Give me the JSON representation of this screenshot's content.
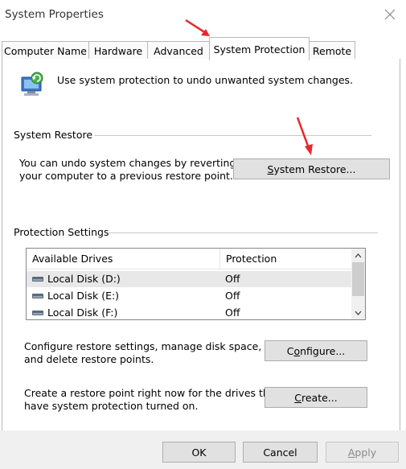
{
  "window": {
    "title": "System Properties"
  },
  "tabs": [
    {
      "label": "Computer Name"
    },
    {
      "label": "Hardware"
    },
    {
      "label": "Advanced"
    },
    {
      "label": "System Protection"
    },
    {
      "label": "Remote"
    }
  ],
  "intro": {
    "text": "Use system protection to undo unwanted system changes."
  },
  "system_restore": {
    "heading": "System Restore",
    "desc_line1": "You can undo system changes by reverting",
    "desc_line2": "your computer to a previous restore point.",
    "button": {
      "mnemonic": "S",
      "rest": "ystem Restore..."
    }
  },
  "protection": {
    "heading": "Protection Settings",
    "columns": [
      "Available Drives",
      "Protection"
    ],
    "drives": [
      {
        "name": "Local Disk (D:)",
        "protection": "Off"
      },
      {
        "name": "Local Disk (E:)",
        "protection": "Off"
      },
      {
        "name": "Local Disk (F:)",
        "protection": "Off"
      }
    ],
    "configure_line1": "Configure restore settings, manage disk space,",
    "configure_line2": "and delete restore points.",
    "configure_button": {
      "pre": "C",
      "mnemonic": "o",
      "rest": "nfigure..."
    },
    "create_line1": "Create a restore point right now for the drives that",
    "create_line2": "have system protection turned on.",
    "create_button": {
      "mnemonic": "C",
      "rest": "reate..."
    }
  },
  "footer": {
    "ok": "OK",
    "cancel": "Cancel",
    "apply_mnemonic": "A",
    "apply_rest": "pply"
  },
  "colors": {
    "annotation_arrow": "#e8262a"
  }
}
